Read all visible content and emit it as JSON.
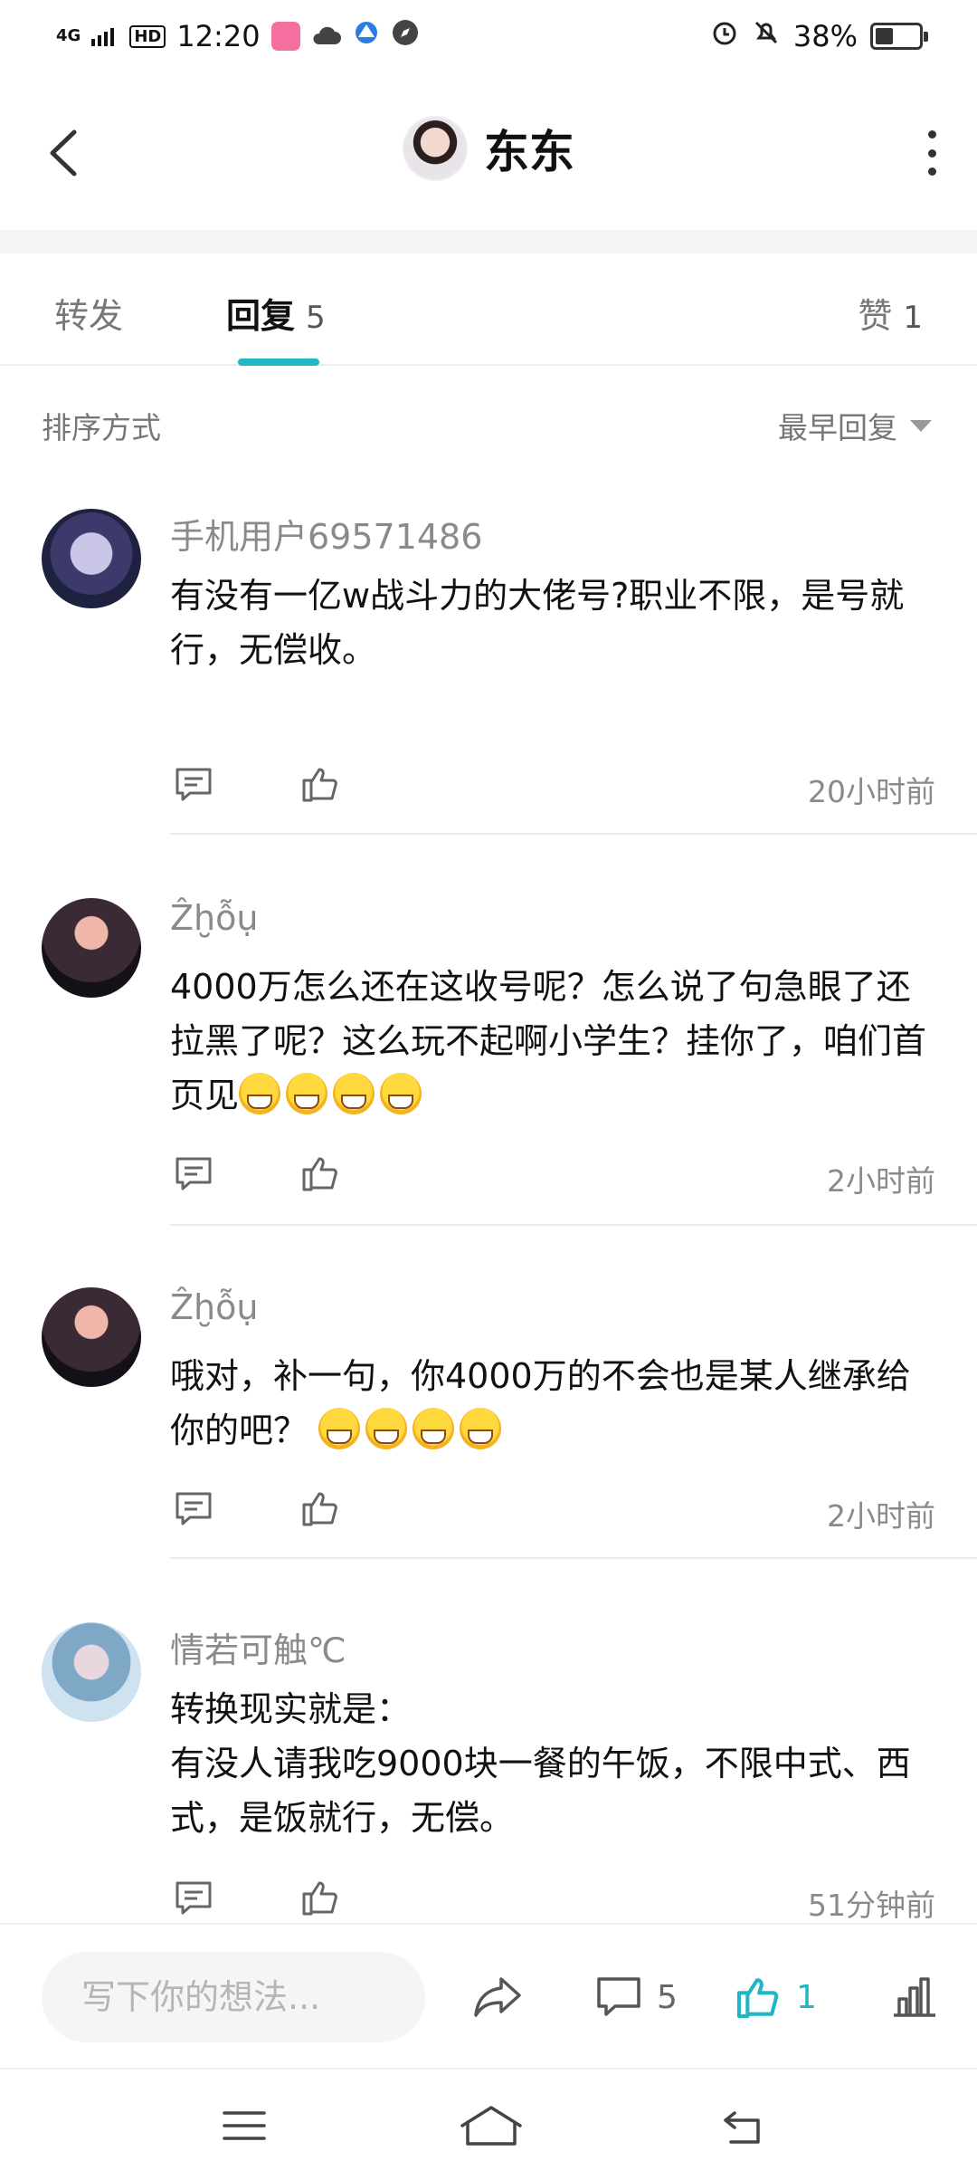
{
  "status_bar": {
    "network": "4G",
    "hd": "HD",
    "time": "12:20",
    "battery": "38%"
  },
  "header": {
    "title": "东东"
  },
  "tabs": {
    "forward": "转发",
    "reply": "回复",
    "reply_count": "5",
    "like": "赞",
    "like_count": "1"
  },
  "sort": {
    "label": "排序方式",
    "selected": "最早回复"
  },
  "comments": [
    {
      "user": "手机用户69571486",
      "text": "有没有一亿w战斗力的大佬号?职业不限，是号就行，无偿收。",
      "time": "20小时前"
    },
    {
      "user": "Ẑḫỗụ",
      "text": "4000万怎么还在这收号呢？怎么说了句急眼了还拉黑了呢？这么玩不起啊小学生？挂你了，咱们首页见",
      "emoji_count": 4,
      "time": "2小时前"
    },
    {
      "user": "Ẑḫỗụ",
      "text": "哦对，补一句，你4000万的不会也是某人继承给你的吧？",
      "emoji_count": 4,
      "time": "2小时前"
    },
    {
      "user": "情若可触℃",
      "text_line1": "转换现实就是：",
      "text_line2": "有没人请我吃9000块一餐的午饭，不限中式、西式，是饭就行，无偿。",
      "time": "51分钟前"
    }
  ],
  "bottom_bar": {
    "placeholder": "写下你的想法...",
    "comment_count": "5",
    "like_count": "1"
  },
  "colors": {
    "accent": "#1fb7c4",
    "muted_text": "#8a8a8a"
  }
}
